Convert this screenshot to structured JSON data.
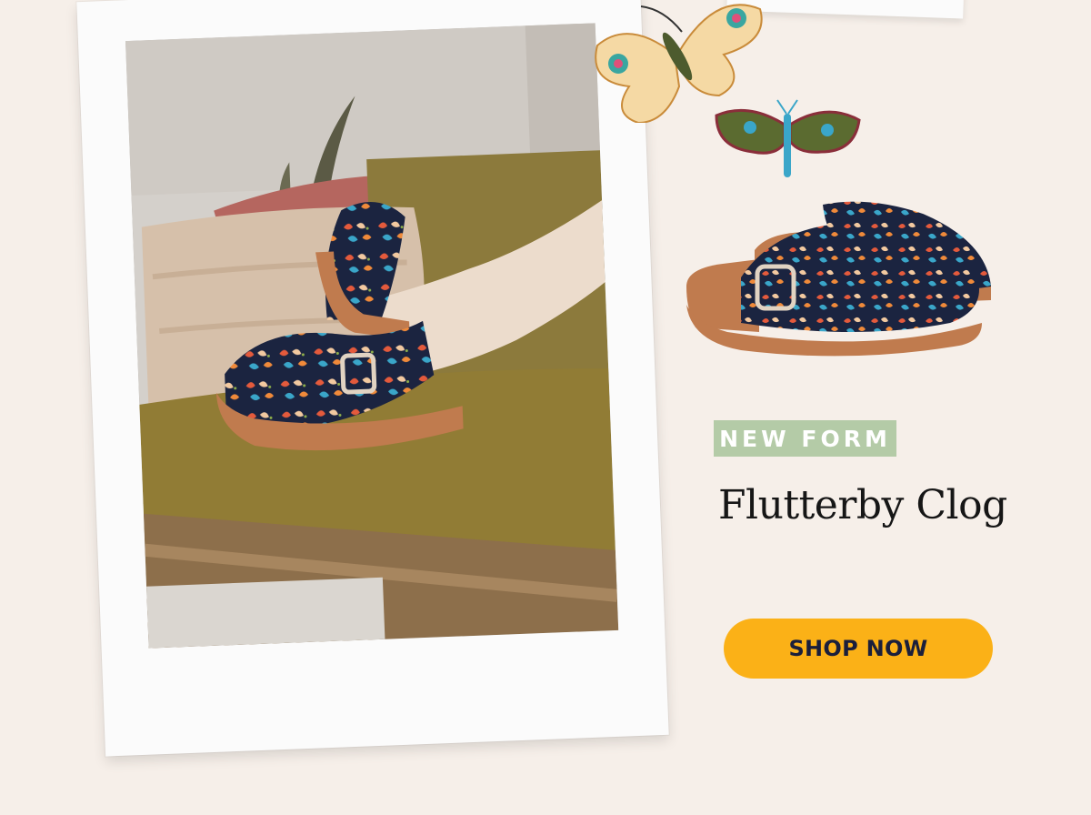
{
  "badge": {
    "label": "NEW FORM"
  },
  "product": {
    "name": "Flutterby Clog"
  },
  "cta": {
    "label": "SHOP NOW"
  },
  "colors": {
    "background": "#f6efe9",
    "badge": "#b4cba7",
    "cta": "#fbb117",
    "cta_text": "#1b1f3b",
    "clog_navy": "#1b2440",
    "sole": "#c07b4e"
  },
  "icons": [
    "butterfly-icon-large",
    "butterfly-icon-small"
  ]
}
